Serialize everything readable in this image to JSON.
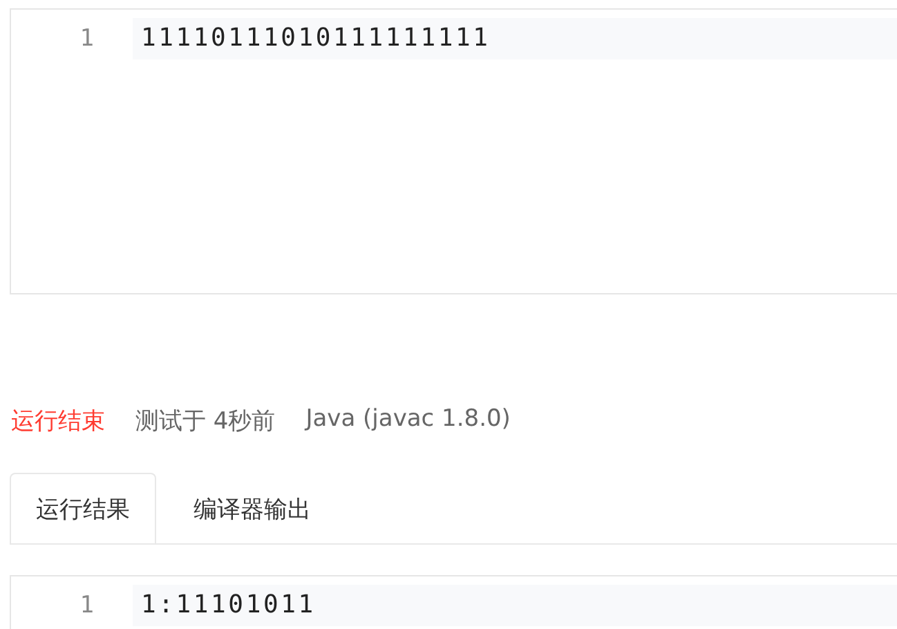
{
  "input_editor": {
    "lines": [
      {
        "number": "1",
        "text": "11110111010111111111"
      }
    ]
  },
  "status_bar": {
    "result": {
      "text": "运行结束",
      "kind": "finished"
    },
    "tested": "测试于 4秒前",
    "language": "Java (javac 1.8.0)"
  },
  "tabs": [
    {
      "label": "运行结果",
      "selected": true
    },
    {
      "label": "编译器输出",
      "selected": false
    }
  ],
  "output_editor": {
    "lines": [
      {
        "number": "1",
        "text": "1:11101011"
      }
    ]
  }
}
